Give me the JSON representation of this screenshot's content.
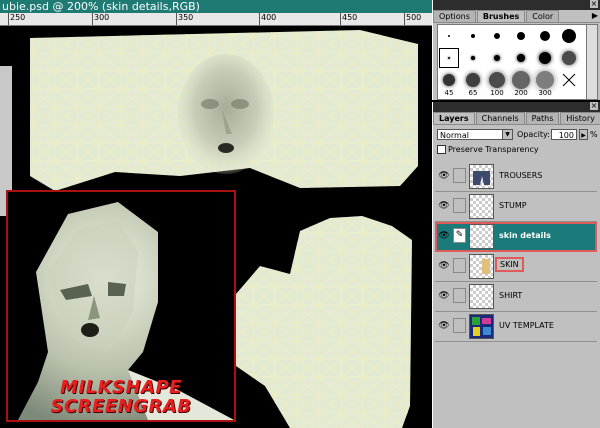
{
  "document": {
    "title": "ubie.psd @ 200% (skin details,RGB)",
    "ruler_labels": [
      "250",
      "300",
      "350",
      "400",
      "450",
      "500"
    ],
    "inset_caption_line1": "MILKSHAPE",
    "inset_caption_line2": "SCREENGRAB"
  },
  "brushes_palette": {
    "tabs": [
      {
        "label": "Options",
        "active": false
      },
      {
        "label": "Brushes",
        "active": true
      },
      {
        "label": "Color",
        "active": false
      }
    ],
    "size_labels": [
      "45",
      "65",
      "100",
      "200",
      "300"
    ]
  },
  "layers_palette": {
    "tabs": [
      {
        "label": "Layers",
        "active": true
      },
      {
        "label": "Channels",
        "active": false
      },
      {
        "label": "Paths",
        "active": false
      },
      {
        "label": "History",
        "active": false
      }
    ],
    "blend_mode": "Normal",
    "opacity_label": "Opacity:",
    "opacity_value": "100",
    "opacity_unit": "%",
    "preserve_transparency": "Preserve Transparency",
    "layers": [
      {
        "name": "TROUSERS",
        "active": false
      },
      {
        "name": "STUMP",
        "active": false
      },
      {
        "name": "skin details",
        "active": true
      },
      {
        "name": "SKIN",
        "active": false
      },
      {
        "name": "SHIRT",
        "active": false
      },
      {
        "name": "UV TEMPLATE",
        "active": false
      }
    ]
  },
  "colors": {
    "title_bar": "#1f7a74",
    "active_layer": "#1b7a7a",
    "uv_skin": "#e2ead3",
    "uv_lines": "#f5f0b0",
    "caption_red": "#e81f1f"
  }
}
